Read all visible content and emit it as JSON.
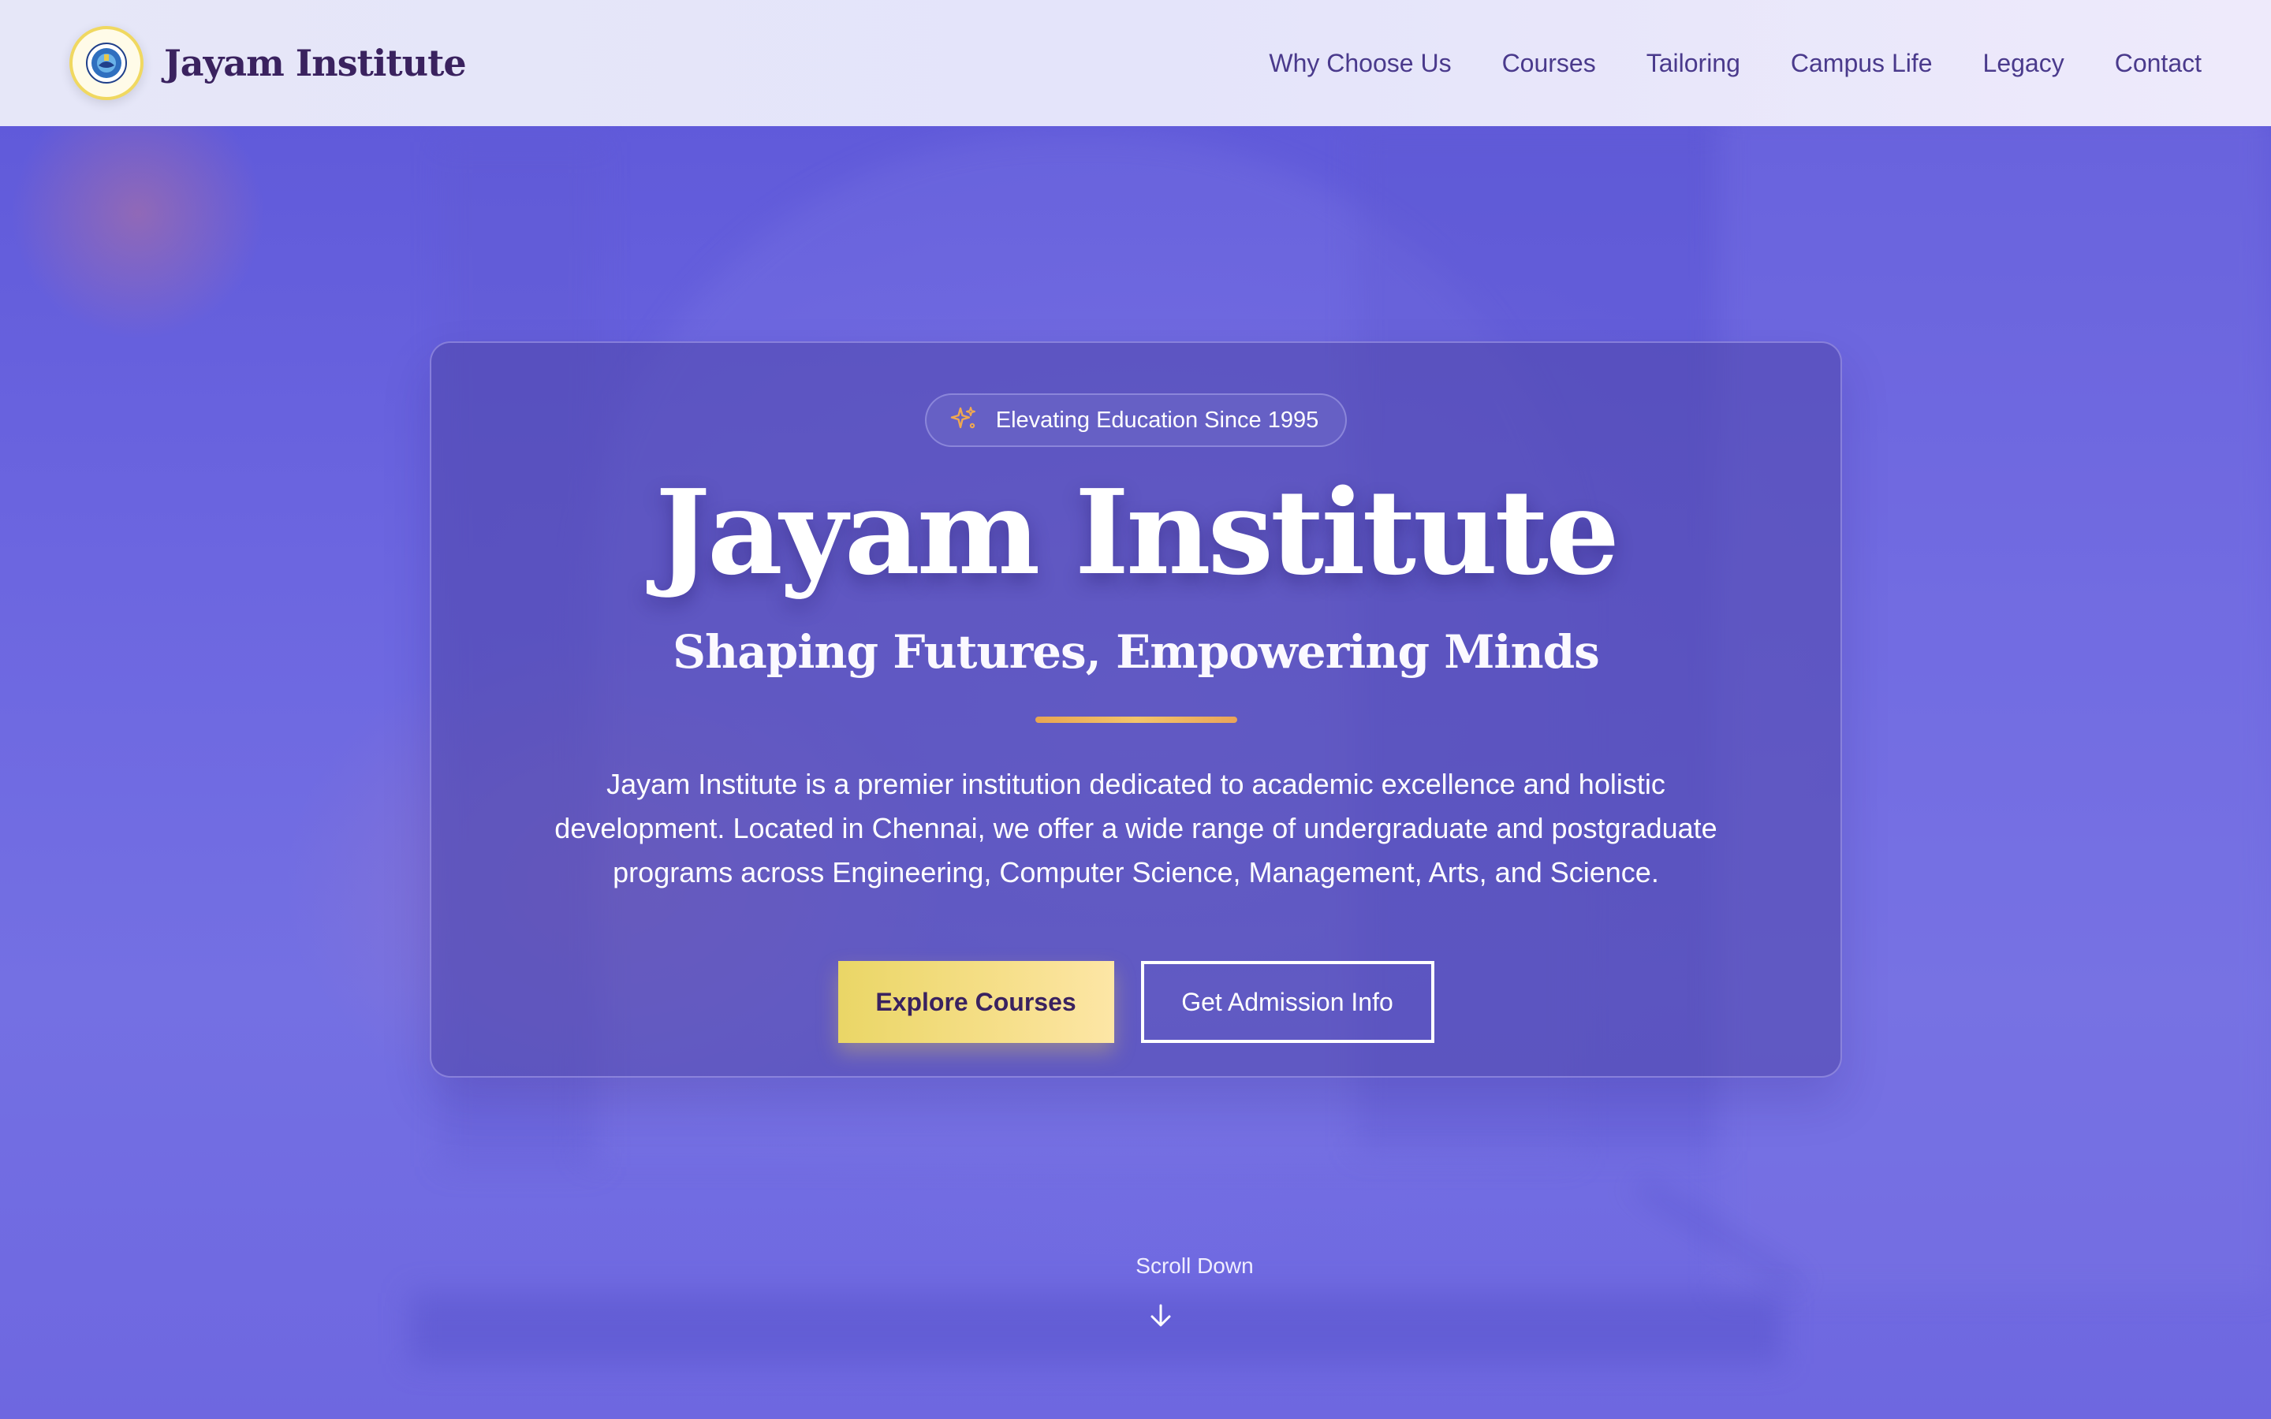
{
  "brand": {
    "name": "Jayam Institute",
    "logo_icon": "institute-seal-icon"
  },
  "nav": {
    "links": [
      "Why Choose Us",
      "Courses",
      "Tailoring",
      "Campus Life",
      "Legacy",
      "Contact"
    ]
  },
  "hero": {
    "badge_icon": "sparkles-icon",
    "badge_text": "Elevating Education Since 1995",
    "title": "Jayam Institute",
    "subtitle": "Shaping Futures, Empowering Minds",
    "description": "Jayam Institute is a premier institution dedicated to academic excellence and holistic development. Located in Chennai, we offer a wide range of undergraduate and postgraduate programs across Engineering, Computer Science, Management, Arts, and Science.",
    "primary_cta": "Explore Courses",
    "secondary_cta": "Get Admission Info"
  },
  "scroll": {
    "label": "Scroll Down",
    "icon": "arrow-down-icon"
  },
  "colors": {
    "brand_text": "#3a225f",
    "nav_text": "#4a3a8c",
    "hero_bg": "#6c63e0",
    "accent_gold": "#ead666",
    "accent_orange": "#e8a552"
  }
}
